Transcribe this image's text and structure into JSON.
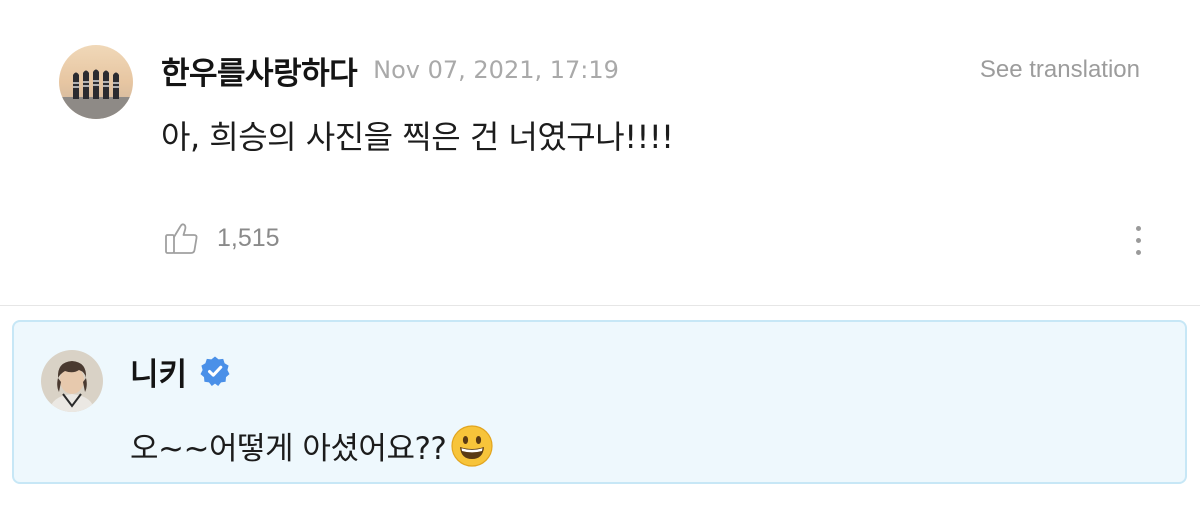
{
  "comment": {
    "author": "한우를사랑하다",
    "timestamp": "Nov 07, 2021, 17:19",
    "translate_label": "See translation",
    "text": "아, 희승의 사진을 찍은 건 너였구나!!!!",
    "like_count": "1,515",
    "like_icon": "thumbs-up-icon",
    "more_icon": "vertical-ellipsis-icon"
  },
  "reply": {
    "author": "니키",
    "verified_icon": "verified-badge-icon",
    "text": "오~~어떻게 아셨어요??",
    "emoji": "grinning-face-emoji"
  },
  "colors": {
    "reply_background": "#eef8fd",
    "reply_border": "#c7e7f6",
    "verified_blue": "#4a90e8",
    "timestamp_gray": "#a9a9a9"
  }
}
